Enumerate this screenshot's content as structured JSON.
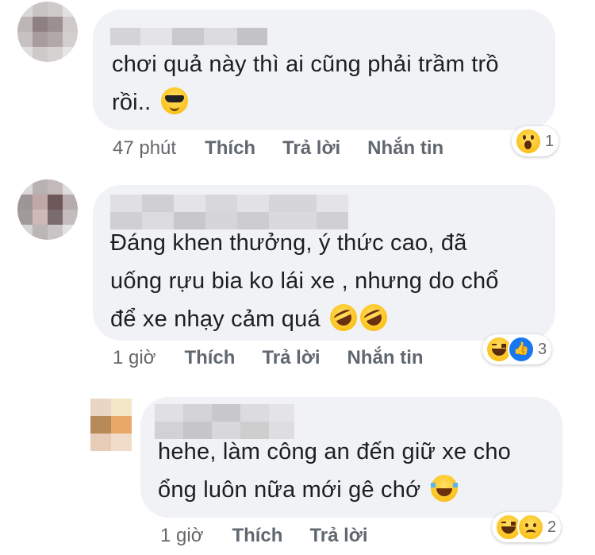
{
  "comments": [
    {
      "text_lines": [
        "chơi quả này thì ai cũng phải trầm trồ",
        "rồi.."
      ],
      "inline_emojis": [
        "smiling-face-with-sunglasses"
      ],
      "time": "47 phút",
      "actions": [
        "Thích",
        "Trả lời",
        "Nhắn tin"
      ],
      "reactions": [
        "wow"
      ],
      "reaction_count": "1"
    },
    {
      "text_lines": [
        "Đáng khen thưởng, ý thức cao, đã",
        "uống rựu bia ko lái xe , nhưng do chổ",
        "để xe nhạy cảm quá"
      ],
      "inline_emojis": [
        "rolling-on-floor-laughing",
        "rolling-on-floor-laughing"
      ],
      "time": "1 giờ",
      "actions": [
        "Thích",
        "Trả lời",
        "Nhắn tin"
      ],
      "reactions": [
        "haha",
        "like"
      ],
      "reaction_count": "3"
    },
    {
      "text_lines": [
        "hehe, làm công an đến giữ xe cho",
        "ổng luôn nữa mới gê chớ"
      ],
      "inline_emojis": [
        "face-with-tears-of-joy"
      ],
      "time": "1 giờ",
      "actions": [
        "Thích",
        "Trả lời"
      ],
      "reactions": [
        "haha",
        "sad"
      ],
      "reaction_count": "2"
    }
  ],
  "colors": {
    "bubble": "#f0f2f5",
    "text": "#1c1e21",
    "meta": "#65676b",
    "like_blue": "#1877f2"
  }
}
